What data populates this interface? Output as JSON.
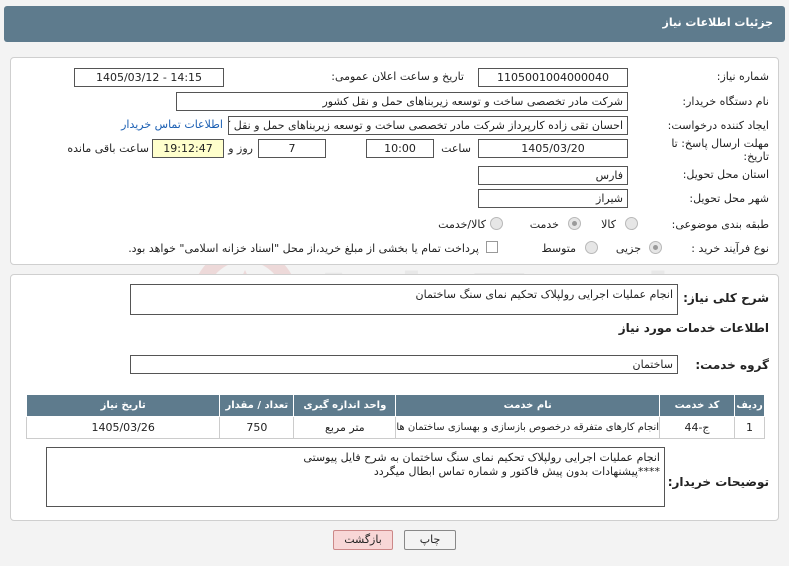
{
  "header": {
    "title": "جزئیات اطلاعات نیاز"
  },
  "form": {
    "need_number_label": "شماره نیاز:",
    "need_number": "1105001004000040",
    "announce_label": "تاریخ و ساعت اعلان عمومی:",
    "announce_value": "1405/03/12 - 14:15",
    "buyer_org_label": "نام دستگاه خریدار:",
    "buyer_org": "شرکت مادر تخصصی ساخت و توسعه زیربناهای حمل و نقل کشور",
    "creator_label": "ایجاد کننده درخواست:",
    "creator": "احسان تقی زاده کارپرداز شرکت مادر تخصصی ساخت و توسعه زیربناهای حمل و نقل کشور",
    "contact_link": "اطلاعات تماس خریدار",
    "deadline_label": "مهلت ارسال پاسخ: تا تاریخ:",
    "deadline_date": "1405/03/20",
    "time_label": "ساعت",
    "deadline_time": "10:00",
    "days": "7",
    "days_label": "روز و",
    "remaining_time": "19:12:47",
    "remaining_label": "ساعت باقی مانده",
    "province_label": "استان محل تحویل:",
    "province": "فارس",
    "city_label": "شهر محل تحویل:",
    "city": "شیراز",
    "category_label": "طبقه بندی موضوعی:",
    "category_options": [
      "کالا",
      "خدمت",
      "کالا/خدمت"
    ],
    "process_label": "نوع فرآیند خرید :",
    "process_options": [
      "جزیی",
      "متوسط"
    ],
    "payment_note": "پرداخت تمام یا بخشی از مبلغ خرید،از محل \"اسناد خزانه اسلامی\" خواهد بود."
  },
  "summary": {
    "label": "شرح کلی نیاز:",
    "text": "انجام عملیات اجرایی رولپلاک  تحکیم نمای سنگ ساختمان"
  },
  "services": {
    "title": "اطلاعات خدمات مورد نیاز",
    "group_label": "گروه خدمت:",
    "group": "ساختمان",
    "columns": [
      "ردیف",
      "کد خدمت",
      "نام خدمت",
      "واحد اندازه گیری",
      "تعداد / مقدار",
      "تاریخ نیاز"
    ],
    "rows": [
      [
        "1",
        "ج-44",
        "انجام کارهای متفرقه درخصوص بازسازی و بهسازی ساختمان ها",
        "متر مربع",
        "750",
        "1405/03/26"
      ]
    ]
  },
  "buyer_notes": {
    "label": "توضیحات خریدار:",
    "line1": "انجام عملیات اجرایی رولپلاک  تحکیم نمای سنگ ساختمان به شرح فایل پیوستی",
    "line2": "****پیشنهادات بدون پیش فاکتور و شماره تماس ابطال میگردد"
  },
  "buttons": {
    "print": "چاپ",
    "back": "بازگشت"
  },
  "watermark_text": "AriaTender.net",
  "colors": {
    "header": "#5e7b8d",
    "remaining_bg": "#ffffcc",
    "back_bg": "#f8d7d7",
    "link": "#1b5fb3"
  }
}
